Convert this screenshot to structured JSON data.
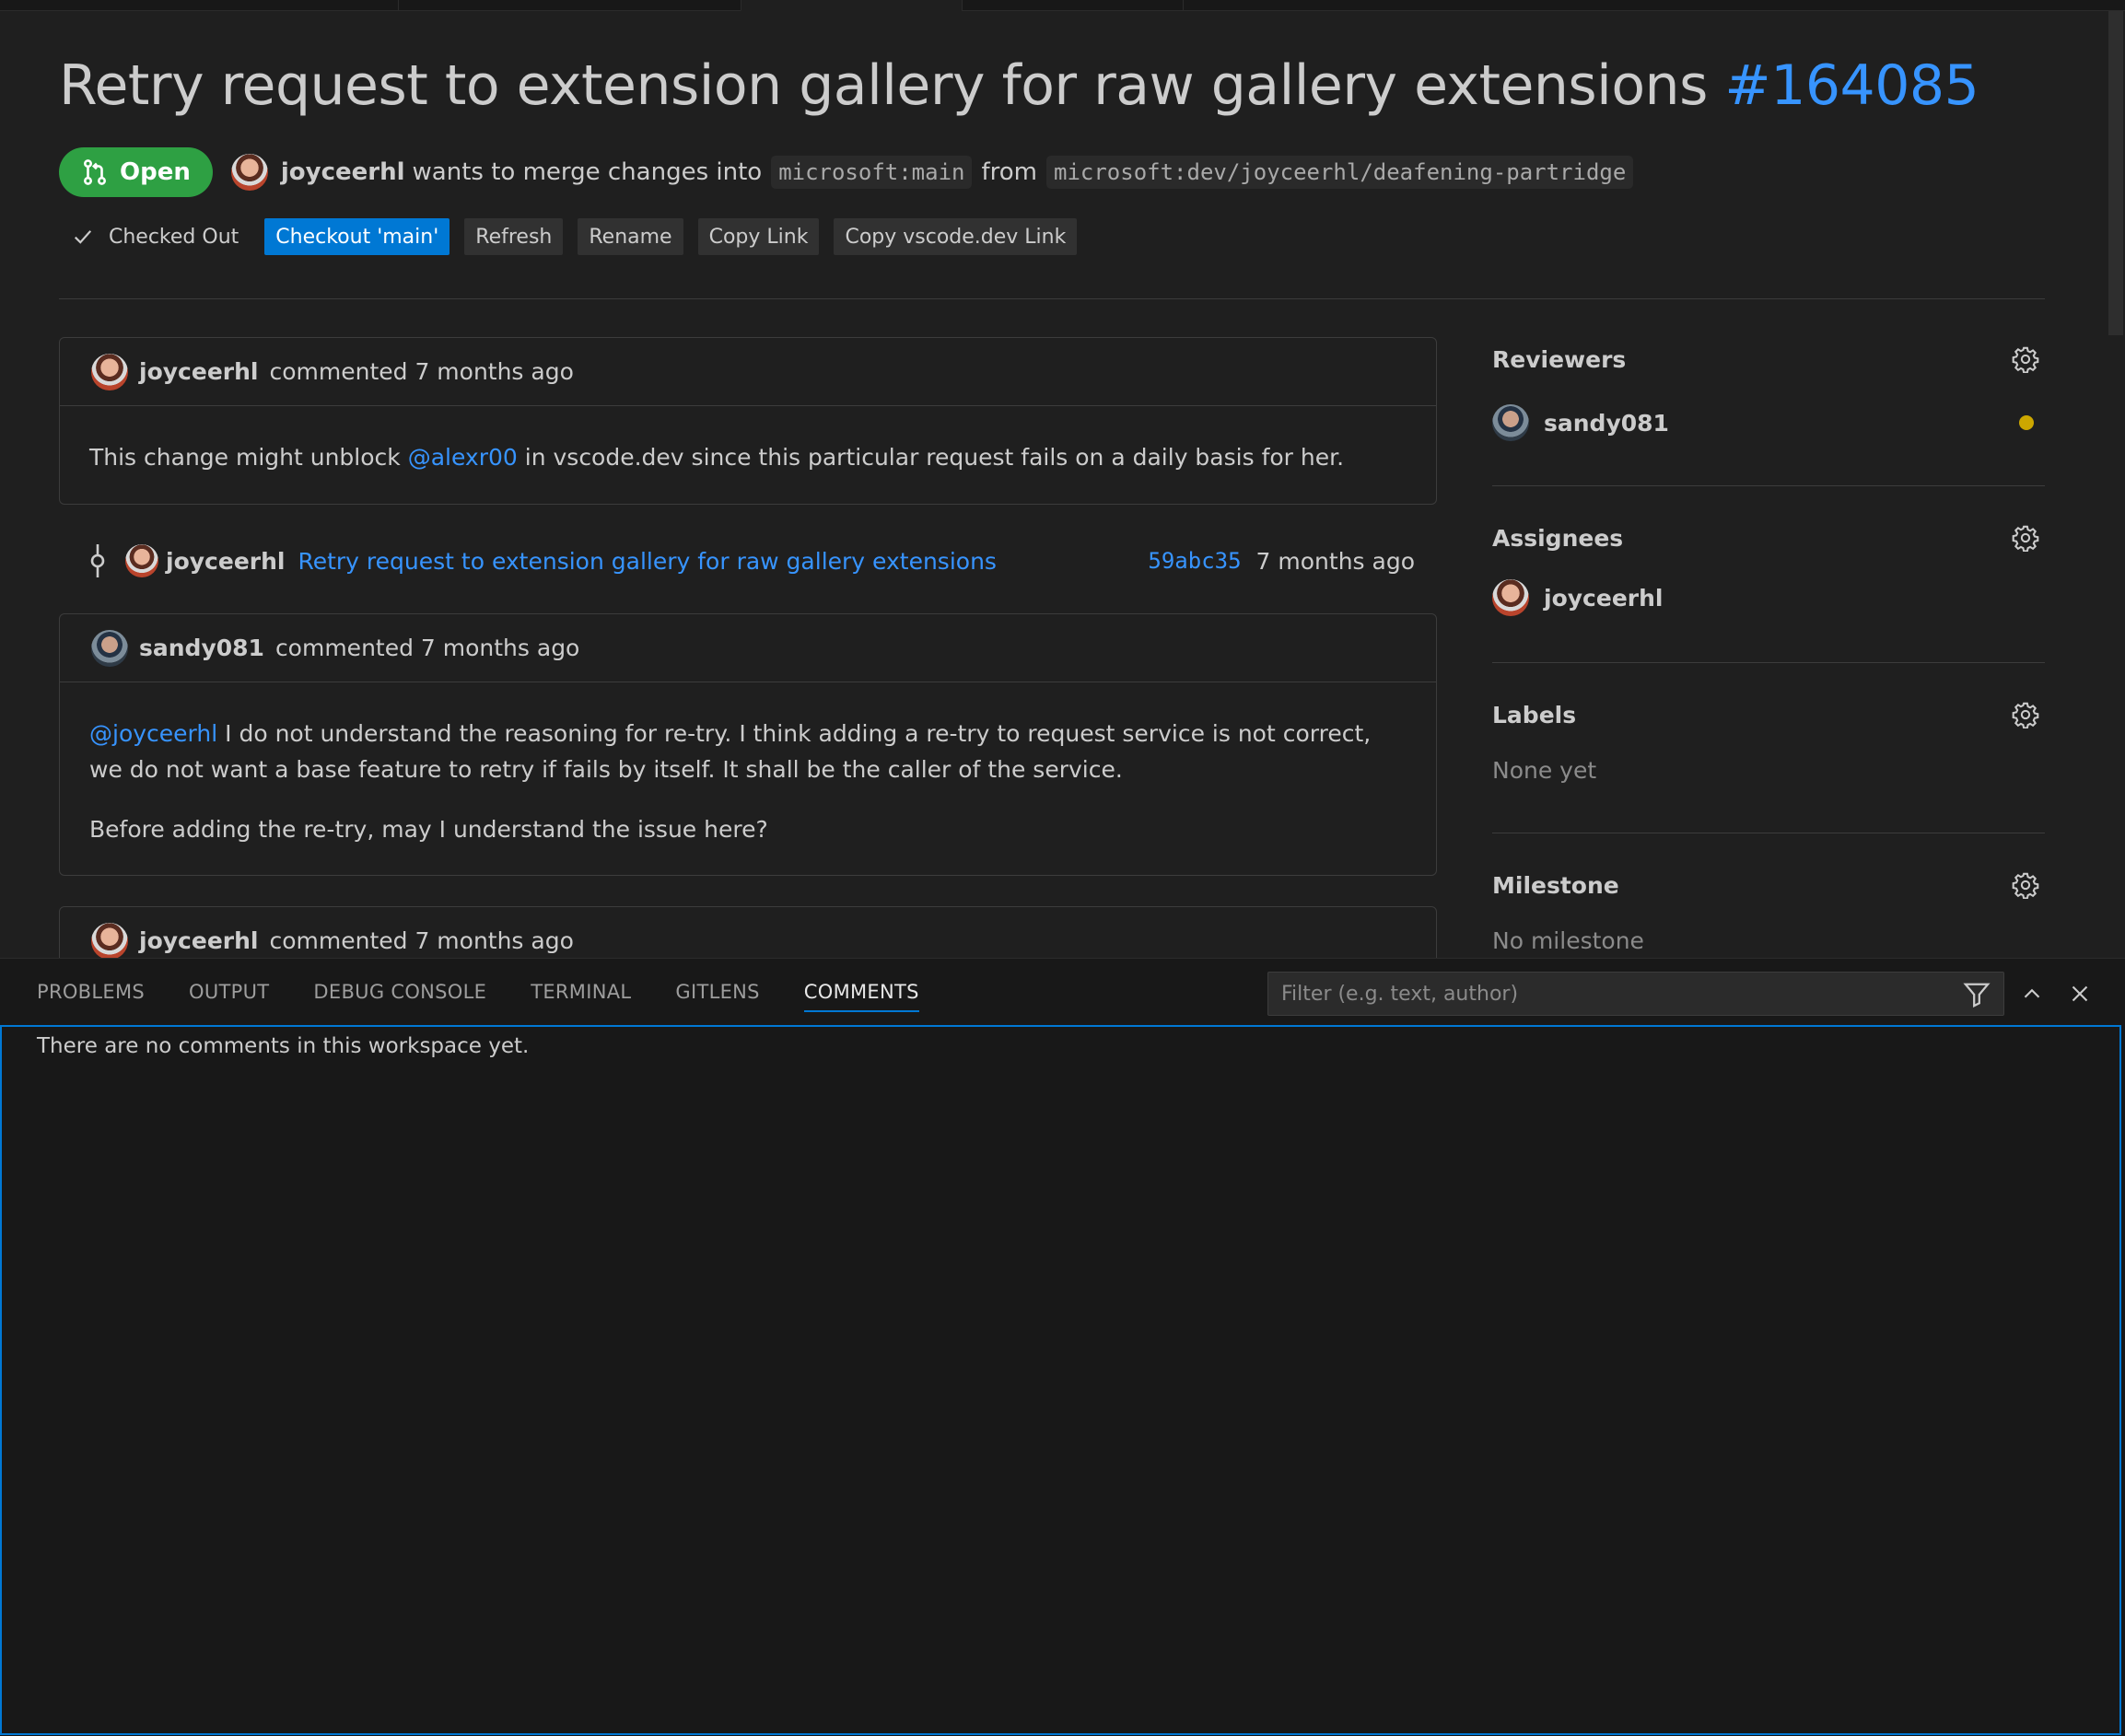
{
  "pull_request": {
    "title": "Retry request to extension gallery for raw gallery extensions",
    "number": "#164085",
    "state": "Open",
    "author": "joyceerhl",
    "merge_text": "wants to merge changes into",
    "target_branch": "microsoft:main",
    "from_text": "from",
    "source_branch": "microsoft:dev/joyceerhl/deafening-partridge"
  },
  "actions": {
    "checked_out": "Checked Out",
    "checkout_main": "Checkout 'main'",
    "refresh": "Refresh",
    "rename": "Rename",
    "copy_link": "Copy Link",
    "copy_vscode_link": "Copy vscode.dev Link"
  },
  "timeline": {
    "comment1": {
      "author": "joyceerhl",
      "meta": "commented 7 months ago",
      "body_before": "This change might unblock ",
      "mention": "@alexr00",
      "body_after": " in vscode.dev since this particular request fails on a daily basis for her."
    },
    "commit": {
      "author": "joyceerhl",
      "message": "Retry request to extension gallery for raw gallery extensions",
      "sha": "59abc35",
      "ago": "7 months ago"
    },
    "comment2": {
      "author": "sandy081",
      "meta": "commented 7 months ago",
      "mention": "@joyceerhl",
      "para1": " I do not understand the reasoning for re-try. I think adding a re-try to request service is not correct, we do not want a base feature to retry if fails by itself. It shall be the caller of the service.",
      "para2": "Before adding the re-try, may I understand the issue here?"
    },
    "comment3": {
      "author": "joyceerhl",
      "meta": "commented 7 months ago"
    }
  },
  "sidebar": {
    "reviewers": {
      "label": "Reviewers",
      "user": "sandy081"
    },
    "assignees": {
      "label": "Assignees",
      "user": "joyceerhl"
    },
    "labels": {
      "label": "Labels",
      "empty": "None yet"
    },
    "milestone": {
      "label": "Milestone",
      "empty": "No milestone"
    }
  },
  "panel": {
    "tabs": [
      "PROBLEMS",
      "OUTPUT",
      "DEBUG CONSOLE",
      "TERMINAL",
      "GITLENS",
      "COMMENTS"
    ],
    "active_tab": "COMMENTS",
    "filter_placeholder": "Filter (e.g. text, author)",
    "empty_message": "There are no comments in this workspace yet."
  },
  "colors": {
    "accent": "#0078d4",
    "link": "#3794ff",
    "open_badge": "#2ea043",
    "pending_dot": "#cca700"
  }
}
